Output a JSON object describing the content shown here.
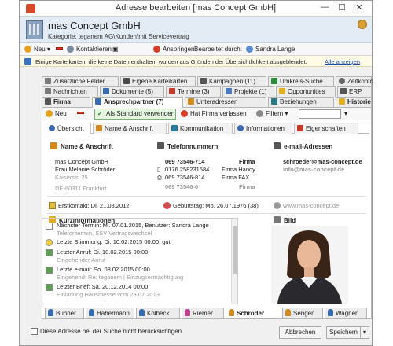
{
  "window": {
    "title": "Adresse bearbeiten [mas Concept GmbH]",
    "minimize": "—",
    "maximize": "☐",
    "close": "✕"
  },
  "header": {
    "name": "mas Concept GmbH",
    "category": "Kategorie: teganem AG\\Kunden\\mit Servicevertrag"
  },
  "toolbar": {
    "new": "Neu",
    "contacts": "Kontaktieren",
    "call": "Anspringen",
    "edited_by_label": "Bearbeitet durch:",
    "edited_by": "Sandra Lange"
  },
  "info": {
    "text": "Einige Karteikarten, die keine Daten enthalten, wurden aus Gründen der Übersichtlichkeit ausgeblendet.",
    "link": "Alle anzeigen"
  },
  "tabs_row1": [
    "Zusätzliche Felder",
    "Eigene Karteikarten",
    "Kampagnen (11)",
    "Umkreis-Suche",
    "Zeitkonto"
  ],
  "tabs_row2": [
    "Nachrichten",
    "Dokumente (5)",
    "Termine (3)",
    "Projekte (1)",
    "Opportunities",
    "ERP"
  ],
  "tabs_row3": [
    "Firma",
    "Ansprechpartner (7)",
    "Unteradressen",
    "Beziehungen",
    "Historie"
  ],
  "subtoolbar": {
    "new": "Neu",
    "use_default": "Als Standard verwenden",
    "left_company": "Hat Firma verlassen",
    "filter": "Filtern"
  },
  "inner_tabs": [
    "Übersicht",
    "Name & Anschrift",
    "Kommunikation",
    "Informationen",
    "Eigenschaften"
  ],
  "address": {
    "heading": "Name & Anschrift",
    "lines": [
      "mas Concept GmbH",
      "Frau Melanie Schröder",
      "Kaiserstr. 25",
      "DE-60311 Frankfurt"
    ]
  },
  "phones": {
    "heading": "Telefonnummern",
    "rows": [
      {
        "number": "069 73546-714",
        "type": "Firma"
      },
      {
        "number": "0176 258231584",
        "type": "Firma Handy"
      },
      {
        "number": "069 73546-814",
        "type": "Firma FAX"
      },
      {
        "number": "069 73546-0",
        "type": "Firma"
      }
    ]
  },
  "email": {
    "heading": "e-mail-Adressen",
    "rows": [
      "schroeder@mas-concept.de",
      "info@mas-concept.de"
    ]
  },
  "first_contact": "Erstkontakt: Di. 21.08.2012",
  "birthday": "Geburtstag: Mo. 26.07.1976 (38)",
  "website": "www.mas-concept.de",
  "kurz": {
    "heading": "Kurzinformationen",
    "rows": [
      {
        "main": "Nächster Termin: Mi. 07.01.2015, Benutzer: Sandra Lange",
        "sub": "Telefontermin, SSV Vertragswechsel"
      },
      {
        "main": "Letzte Stimmung: Di. 10.02.2015 00:00, gut",
        "sub": ""
      },
      {
        "main": "Letzter Anruf: Di. 10.02.2015 00:00",
        "sub": "Eingehender Anruf"
      },
      {
        "main": "Letzte e-mail: So. 08.02.2015 00:00",
        "sub": "Eingehend: Re: teganem | Einzugsermächtigung"
      },
      {
        "main": "Letzter Brief: Sa. 20.12.2014 00:00",
        "sub": "Einladung Hausmesse vom 23.07.2013"
      }
    ]
  },
  "photo_heading": "Bild",
  "contacts_tabs": [
    "Bühner",
    "Habermann",
    "Kolbeck",
    "Riemer",
    "Schröder",
    "Senger",
    "Wagner"
  ],
  "footer": {
    "exclude": "Diese Adresse bei der Suche nicht berücksichtigen",
    "cancel": "Abbrechen",
    "save": "Speichern"
  }
}
